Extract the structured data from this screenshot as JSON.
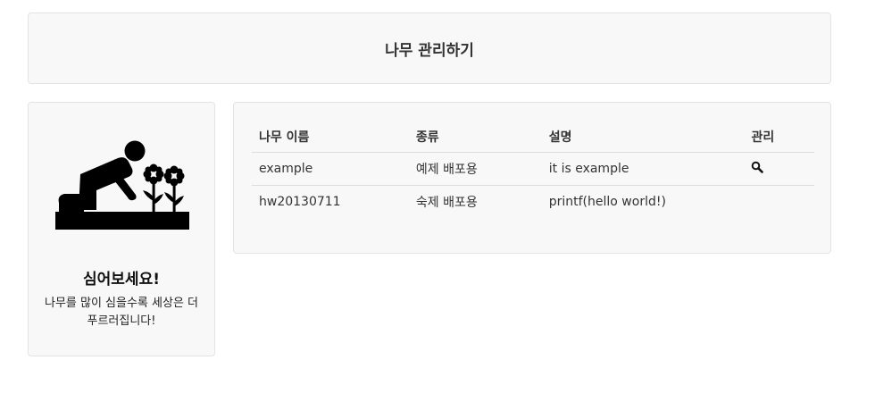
{
  "header": {
    "title": "나무 관리하기"
  },
  "sidebar": {
    "icon": "gardener-planting-flowers-icon",
    "heading": "심어보세요!",
    "text": "나무를 많이 심을수록 세상은 더 푸르러집니다!"
  },
  "table": {
    "columns": [
      "나무 이름",
      "종류",
      "설명",
      "관리"
    ],
    "rows": [
      {
        "name": "example",
        "kind": "예제 배포용",
        "description": "it is example",
        "manage_icon": "search-icon"
      },
      {
        "name": "hw20130711",
        "kind": "숙제 배포용",
        "description": "printf(hello world!)",
        "manage_icon": ""
      }
    ]
  }
}
